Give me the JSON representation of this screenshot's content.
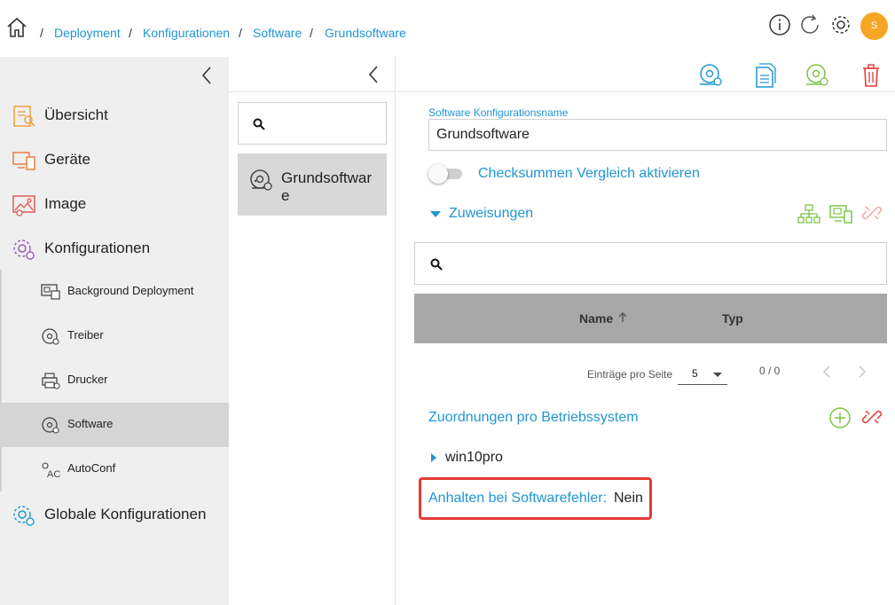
{
  "breadcrumb": {
    "items": [
      "Deployment",
      "Konfigurationen",
      "Software",
      "Grundsoftware"
    ],
    "separator": "/"
  },
  "header": {
    "avatar_letter": "S",
    "icons": [
      "home-icon",
      "info-icon",
      "refresh-icon",
      "settings-icon"
    ]
  },
  "sidebar": {
    "items": [
      {
        "label": "Übersicht",
        "icon": "overview-icon"
      },
      {
        "label": "Geräte",
        "icon": "devices-icon"
      },
      {
        "label": "Image",
        "icon": "image-icon"
      },
      {
        "label": "Konfigurationen",
        "icon": "configurations-icon"
      },
      {
        "label": "Globale Konfigurationen",
        "icon": "global-config-icon"
      }
    ],
    "sub_items": [
      {
        "label": "Background Deployment",
        "icon": "background-deployment-icon"
      },
      {
        "label": "Treiber",
        "icon": "driver-icon"
      },
      {
        "label": "Drucker",
        "icon": "printer-icon"
      },
      {
        "label": "Software",
        "icon": "software-icon",
        "active": true
      },
      {
        "label": "AutoConf",
        "icon": "autoconf-icon"
      }
    ]
  },
  "middle": {
    "search_placeholder": "",
    "list_item": "Grundsoftware"
  },
  "form": {
    "name_label": "Software Konfigurationsname",
    "name_value": "Grundsoftware",
    "checksum_label": "Checksummen Vergleich aktivieren",
    "checksum_enabled": false,
    "assignments_label": "Zuweisungen",
    "table": {
      "columns": [
        "Name",
        "Typ"
      ],
      "sort_column": "Name",
      "sort_direction": "ascending",
      "rows": []
    },
    "pager": {
      "per_page_label": "Einträge pro Seite",
      "per_page_value": "5",
      "range": "0 / 0"
    },
    "os_section_label": "Zuordnungen pro Betriebssystem",
    "os_items": [
      "win10pro"
    ],
    "halt_label": "Anhalten bei Softwarefehler:",
    "halt_value": "Nein"
  },
  "colors": {
    "accent": "#2196d3",
    "green": "#7cc243",
    "red": "#e53935",
    "orange": "#f5a623",
    "sidebar_bg": "#efefef",
    "active_bg": "#d5d5d5"
  }
}
